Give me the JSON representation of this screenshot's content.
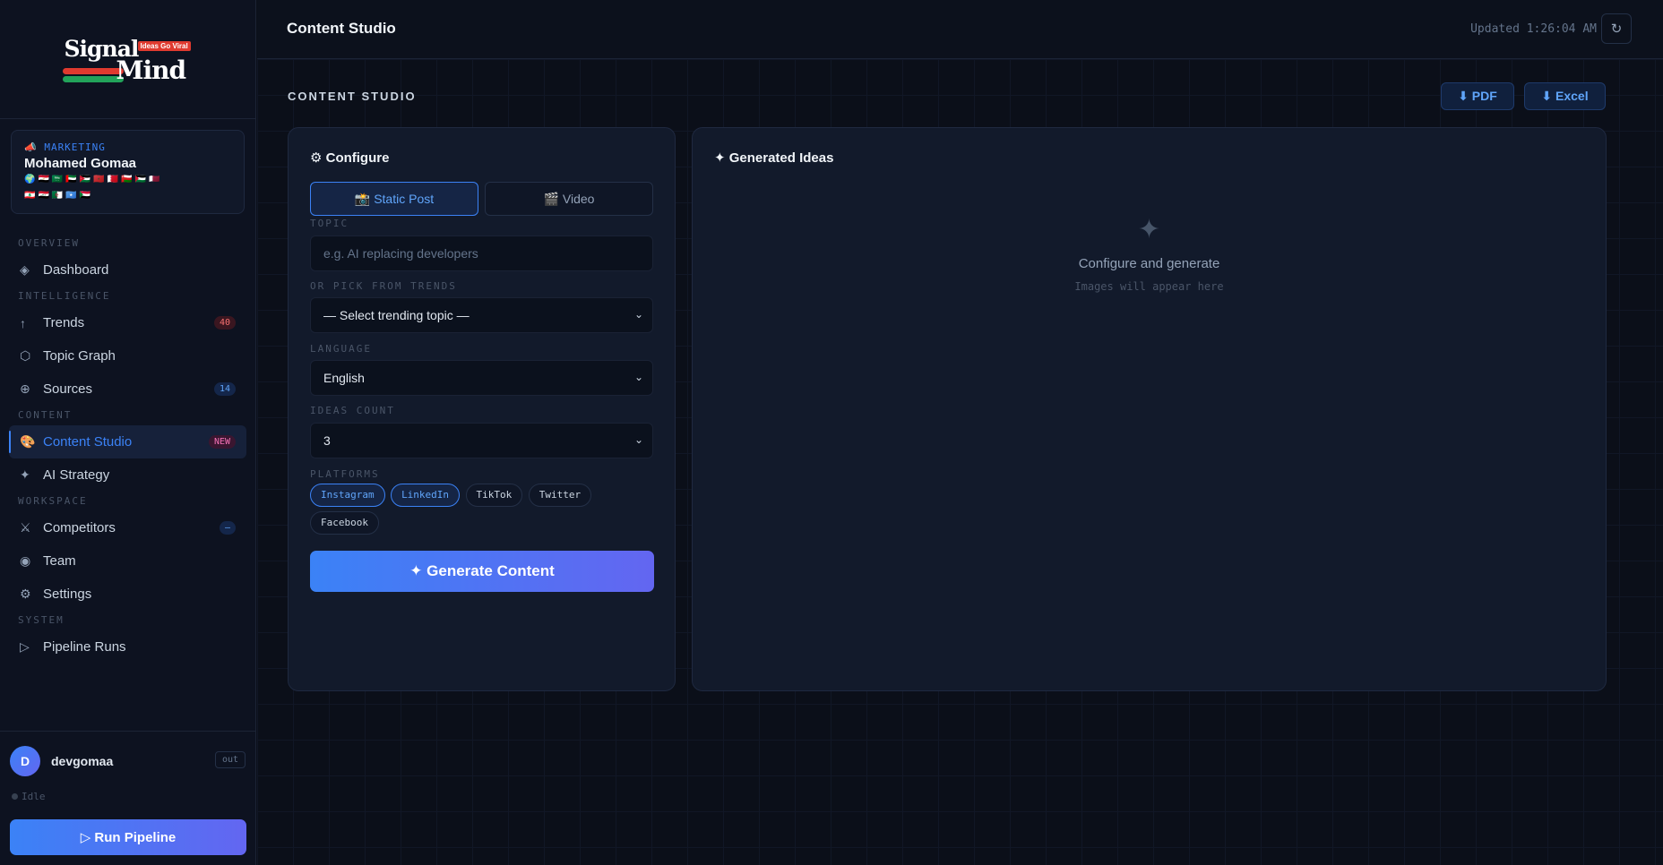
{
  "brand": {
    "line1": "Signal",
    "line2": "Mind",
    "tagline": "Ideas Go Viral"
  },
  "profile": {
    "role": "📣 MARKETING",
    "name": "Mohamed Gomaa",
    "flags_row1": "🌍🇪🇬🇸🇦🇦🇪🇯🇴🇲🇦🇧🇭🇴🇲🇵🇸🇶🇦",
    "flags_row2": "🇱🇧🇮🇶🇩🇿🇸🇴🇸🇩"
  },
  "sidebar": {
    "sections": {
      "overview": "OVERVIEW",
      "intelligence": "INTELLIGENCE",
      "content": "CONTENT",
      "workspace": "WORKSPACE",
      "system": "SYSTEM"
    },
    "items": {
      "dashboard": {
        "label": "Dashboard",
        "icon": "◈"
      },
      "trends": {
        "label": "Trends",
        "icon": "↑",
        "badge": "40"
      },
      "topic_graph": {
        "label": "Topic Graph",
        "icon": "⬡"
      },
      "sources": {
        "label": "Sources",
        "icon": "⊕",
        "badge": "14"
      },
      "content_studio": {
        "label": "Content Studio",
        "icon": "🎨",
        "badge": "NEW"
      },
      "ai_strategy": {
        "label": "AI Strategy",
        "icon": "✦"
      },
      "competitors": {
        "label": "Competitors",
        "icon": "⚔",
        "badge": "–"
      },
      "team": {
        "label": "Team",
        "icon": "◉"
      },
      "settings": {
        "label": "Settings",
        "icon": "⚙"
      },
      "pipeline_runs": {
        "label": "Pipeline Runs",
        "icon": "▷"
      }
    }
  },
  "user": {
    "initial": "D",
    "name": "devgomaa",
    "logout_label": "out",
    "status": "Idle",
    "run_label": "▷ Run Pipeline"
  },
  "topbar": {
    "title": "Content Studio",
    "updated": "Updated 1:26:04 AM",
    "refresh_icon": "↻"
  },
  "page": {
    "heading": "CONTENT STUDIO",
    "export_pdf": "⬇ PDF",
    "export_excel": "⬇ Excel"
  },
  "config": {
    "title": "⚙ Configure",
    "tab_static": "📸 Static Post",
    "tab_video": "🎬 Video",
    "topic_label": "TOPIC",
    "topic_placeholder": "e.g. AI replacing developers",
    "trends_label": "OR PICK FROM TRENDS",
    "trends_value": "— Select trending topic —",
    "language_label": "LANGUAGE",
    "language_value": "English",
    "count_label": "IDEAS COUNT",
    "count_value": "3",
    "platforms_label": "PLATFORMS",
    "platforms": [
      {
        "name": "Instagram",
        "selected": true
      },
      {
        "name": "LinkedIn",
        "selected": true
      },
      {
        "name": "TikTok",
        "selected": false
      },
      {
        "name": "Twitter",
        "selected": false
      },
      {
        "name": "Facebook",
        "selected": false
      }
    ],
    "generate_label": "✦ Generate Content"
  },
  "ideas": {
    "title": "✦ Generated Ideas",
    "empty_icon": "✦",
    "empty_msg": "Configure and generate",
    "empty_sub": "Images will appear here"
  },
  "colors": {
    "accent": "#3b82f6",
    "accent2": "#6366f1",
    "background": "#0b0f19",
    "panel": "#121a2b"
  }
}
